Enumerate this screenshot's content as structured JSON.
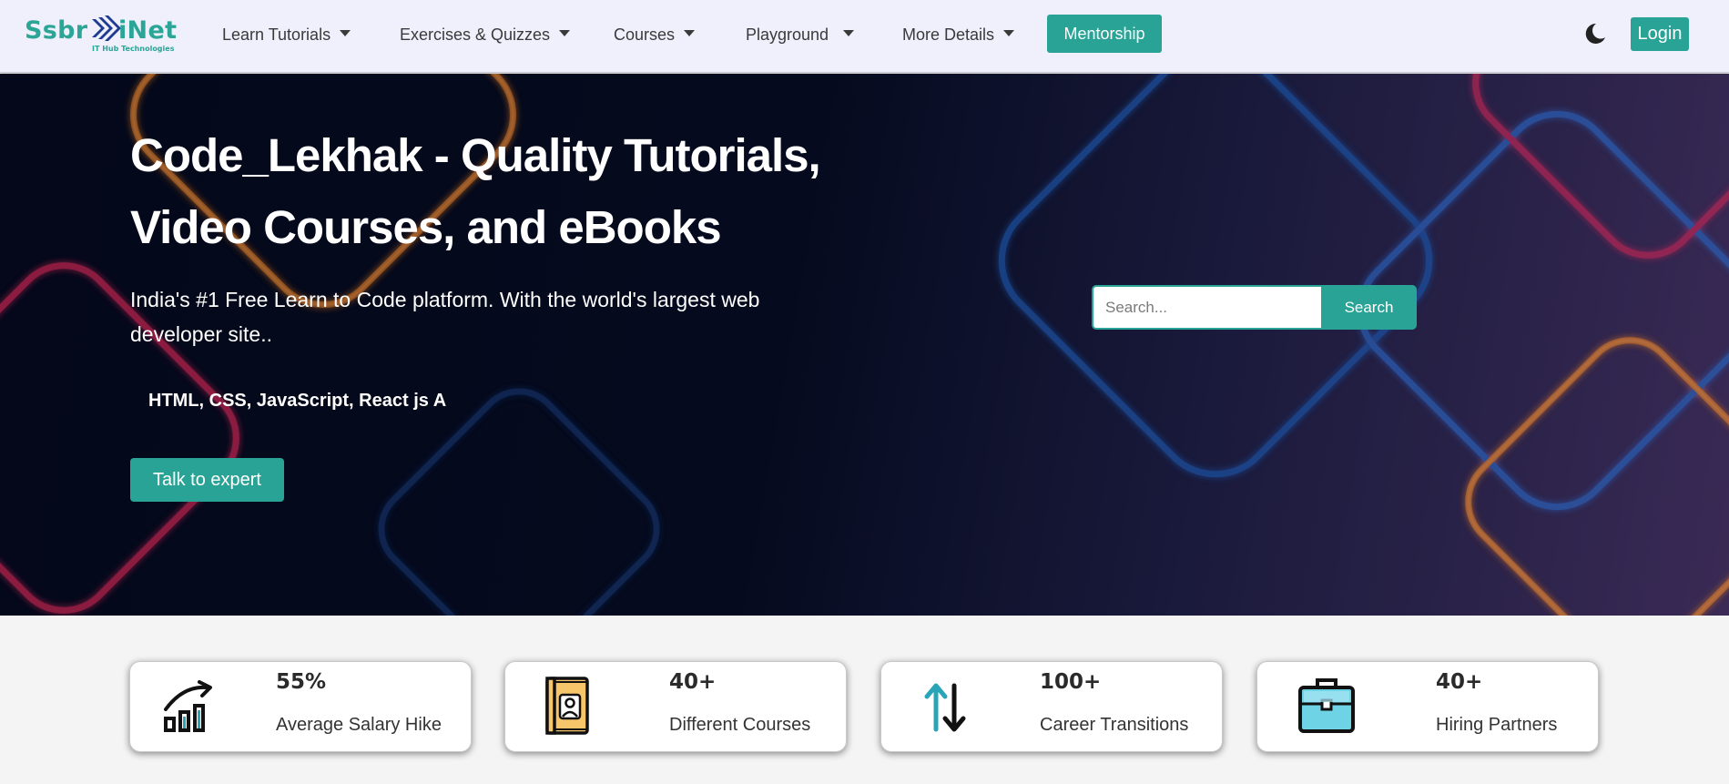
{
  "brand": {
    "name_left": "Ssbr",
    "name_right": "iNet",
    "tagline": "IT Hub Technologies",
    "color": "#2aa596"
  },
  "nav": {
    "items": [
      {
        "label": "Learn Tutorials"
      },
      {
        "label": "Exercises & Quizzes"
      },
      {
        "label": "Courses"
      },
      {
        "label": "Playground"
      },
      {
        "label": "More Details"
      }
    ],
    "mentorship_label": "Mentorship",
    "theme_icon": "moon-icon",
    "login_label": "Login"
  },
  "hero": {
    "title_line1": "Code_Lekhak - Quality Tutorials,",
    "title_line2": "Video Courses, and eBooks",
    "subtitle": "India's #1 Free Learn to Code platform. With the world's largest web developer site..",
    "typed_text": "HTML, CSS, JavaScript, React js A",
    "cta_label": "Talk to expert",
    "search": {
      "placeholder": "Search...",
      "button_label": "Search"
    }
  },
  "stats": [
    {
      "value": "55%",
      "label": "Average Salary Hike",
      "icon": "chart-growth-icon"
    },
    {
      "value": "40+",
      "label": "Different Courses",
      "icon": "book-icon"
    },
    {
      "value": "100+",
      "label": "Career Transitions",
      "icon": "up-down-arrows-icon"
    },
    {
      "value": "40+",
      "label": "Hiring Partners",
      "icon": "briefcase-icon"
    }
  ],
  "colors": {
    "accent": "#29a395",
    "nav_bg": "#eff0fc",
    "hero_bg": "#04081a",
    "page_bg": "#f4f4f4"
  }
}
